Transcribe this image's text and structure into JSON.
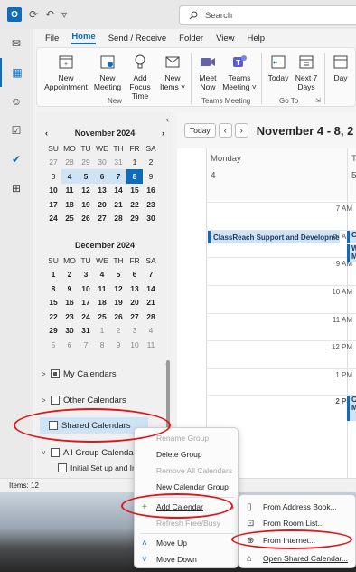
{
  "titlebar": {
    "app_icon": "O",
    "search_placeholder": "Search"
  },
  "ribbon": {
    "tabs": [
      "File",
      "Home",
      "Send / Receive",
      "Folder",
      "View",
      "Help"
    ],
    "buttons": [
      {
        "label": "New Appointment"
      },
      {
        "label": "New Meeting"
      },
      {
        "label": "Add Focus Time"
      },
      {
        "label": "New Items ˅"
      },
      {
        "label": "Meet Now"
      },
      {
        "label": "Teams Meeting ˅"
      },
      {
        "label": "Today"
      },
      {
        "label": "Next 7 Days"
      },
      {
        "label": "Day"
      }
    ],
    "groups": [
      "New",
      "Teams Meeting",
      "Go To"
    ]
  },
  "mini_calendars": [
    {
      "title": "November 2024",
      "dow": [
        "SU",
        "MO",
        "TU",
        "WE",
        "TH",
        "FR",
        "SA"
      ],
      "weeks": [
        [
          "27",
          "28",
          "29",
          "30",
          "31",
          "1",
          "2"
        ],
        [
          "3",
          "4",
          "5",
          "6",
          "7",
          "8",
          "9"
        ],
        [
          "10",
          "11",
          "12",
          "13",
          "14",
          "15",
          "16"
        ],
        [
          "17",
          "18",
          "19",
          "20",
          "21",
          "22",
          "23"
        ],
        [
          "24",
          "25",
          "26",
          "27",
          "28",
          "29",
          "30"
        ]
      ]
    },
    {
      "title": "December 2024",
      "dow": [
        "SU",
        "MO",
        "TU",
        "WE",
        "TH",
        "FR",
        "SA"
      ],
      "weeks": [
        [
          "1",
          "2",
          "3",
          "4",
          "5",
          "6",
          "7"
        ],
        [
          "8",
          "9",
          "10",
          "11",
          "12",
          "13",
          "14"
        ],
        [
          "15",
          "16",
          "17",
          "18",
          "19",
          "20",
          "21"
        ],
        [
          "22",
          "23",
          "24",
          "25",
          "26",
          "27",
          "28"
        ],
        [
          "29",
          "30",
          "31",
          "1",
          "2",
          "3",
          "4"
        ],
        [
          "5",
          "6",
          "7",
          "8",
          "9",
          "10",
          "11"
        ]
      ]
    }
  ],
  "folders": {
    "my_calendars": "My Calendars",
    "other_calendars": "Other Calendars",
    "shared_calendars": "Shared Calendars",
    "all_group": "All Group Calenda",
    "sub_item": "Initial Set up and Im"
  },
  "calendar": {
    "today_label": "Today",
    "range": "November 4 - 8, 2",
    "days": [
      {
        "name": "Monday",
        "date": "4"
      },
      {
        "name": "Tu",
        "date": "5"
      }
    ],
    "times": [
      "7 AM",
      "8 AM",
      "9 AM",
      "10 AM",
      "11 AM",
      "12 PM",
      "1 PM",
      "2 PM"
    ],
    "event1": "ClassReach Support and Developmen",
    "event1_tue": "C",
    "event1b_tue": "W M",
    "event2_tue": "C M"
  },
  "status": {
    "items": "Items: 12"
  },
  "context_menu": {
    "rename": "Rename Group",
    "delete": "Delete Group",
    "remove_all": "Remove All Calendars",
    "new_group": "New Calendar Group",
    "add_calendar": "Add Calendar",
    "refresh": "Refresh Free/Busy",
    "move_up": "Move Up",
    "move_down": "Move Down"
  },
  "submenu": {
    "address_book": "From Address Book...",
    "room_list": "From Room List...",
    "internet": "From Internet...",
    "open_shared": "Open Shared Calendar..."
  },
  "colors": {
    "accent": "#0f6cbd",
    "highlight_ring": "#e0151a"
  }
}
